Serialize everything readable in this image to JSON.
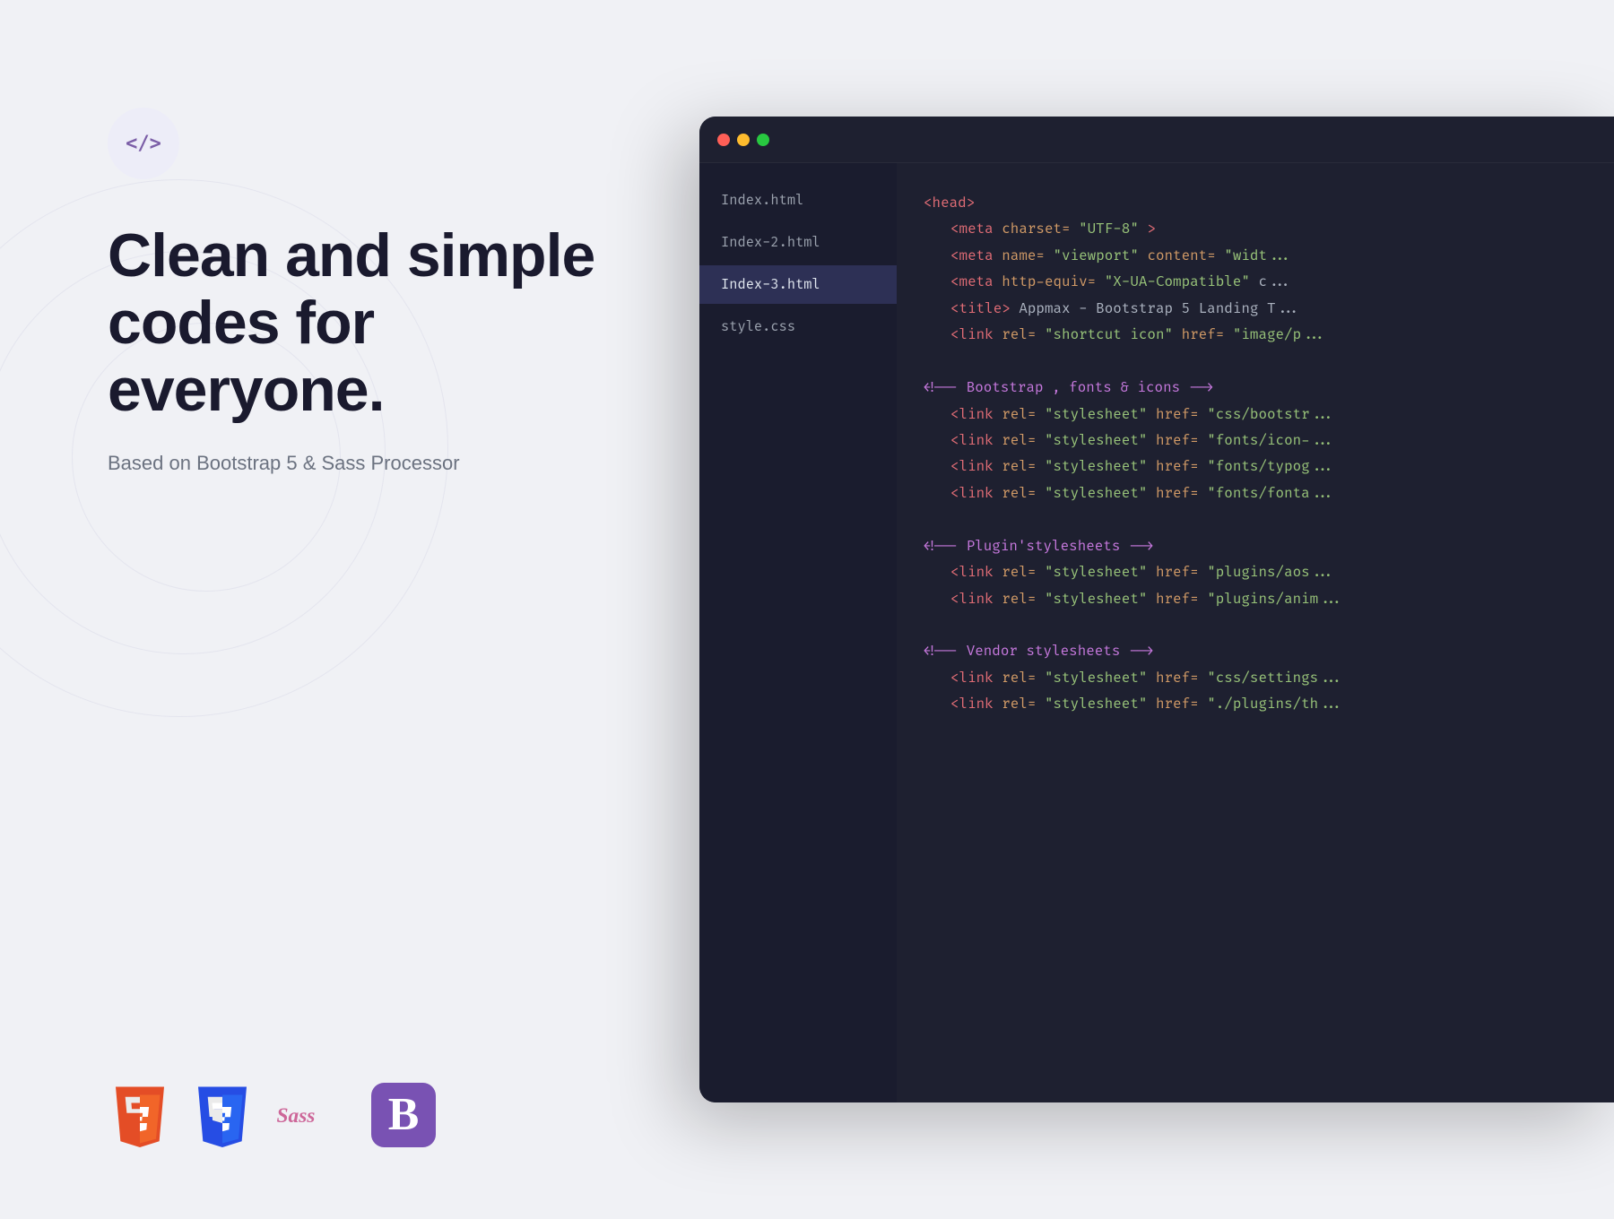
{
  "page": {
    "background_color": "#f0f1f5"
  },
  "left": {
    "icon_label": "</>",
    "hero_title": "Clean and simple codes for everyone.",
    "hero_subtitle": "Based on Bootstrap 5 & Sass Processor",
    "tech_logos": [
      "HTML5",
      "CSS3",
      "Sass",
      "Bootstrap"
    ]
  },
  "editor": {
    "titlebar": {
      "dots": [
        "red",
        "yellow",
        "green"
      ]
    },
    "sidebar": {
      "files": [
        {
          "name": "Index.html",
          "active": false
        },
        {
          "name": "Index-2.html",
          "active": false
        },
        {
          "name": "Index-3.html",
          "active": true
        },
        {
          "name": "style.css",
          "active": false
        }
      ]
    },
    "code_lines": [
      {
        "type": "tag",
        "text": "<head>"
      },
      {
        "type": "indent_mixed",
        "tag": "<meta",
        "attr": " charset=",
        "value": "\"UTF-8\"",
        "close": ">"
      },
      {
        "type": "indent_mixed",
        "tag": "<meta",
        "attr": " name=",
        "value": "\"viewport\"",
        "extra_attr": " content=",
        "extra_value": "\"widt..."
      },
      {
        "type": "indent_mixed",
        "tag": "<meta",
        "attr": " http-equiv=",
        "value": "\"X-UA-Compatible\"",
        "extra": " c..."
      },
      {
        "type": "indent_mixed",
        "tag": "<title>",
        "text": " Appmax - Bootstrap 5 Landing T..."
      },
      {
        "type": "indent_mixed",
        "tag": "<link",
        "attr": " rel=",
        "value": "\"shortcut icon\"",
        "extra_attr": " href=",
        "extra_value": "\"image/p..."
      },
      {
        "type": "blank"
      },
      {
        "type": "comment",
        "text": "<!-- Bootstrap , fonts & icons -->"
      },
      {
        "type": "indent_link",
        "attr": "rel=",
        "value": "\"stylesheet\"",
        "extra_attr": " href=",
        "extra_value": "\"css/bootstr..."
      },
      {
        "type": "indent_link",
        "attr": "rel=",
        "value": "\"stylesheet\"",
        "extra_attr": " href=",
        "extra_value": "\"fonts/icon-..."
      },
      {
        "type": "indent_link",
        "attr": "rel=",
        "value": "\"stylesheet\"",
        "extra_attr": " href=",
        "extra_value": "\"fonts/typog..."
      },
      {
        "type": "indent_link",
        "attr": "rel=",
        "value": "\"stylesheet\"",
        "extra_attr": " href=",
        "extra_value": "\"fonts/fonta..."
      },
      {
        "type": "blank"
      },
      {
        "type": "comment",
        "text": "<!-- Plugin'stylesheets -->"
      },
      {
        "type": "indent_link",
        "attr": "rel=",
        "value": "\"stylesheet\"",
        "extra_attr": " href=",
        "extra_value": "\"plugins/aos..."
      },
      {
        "type": "indent_link",
        "attr": "rel=",
        "value": "\"stylesheet\"",
        "extra_attr": " href=",
        "extra_value": "\"plugins/anim..."
      },
      {
        "type": "blank"
      },
      {
        "type": "comment",
        "text": "<!-- Vendor stylesheets -->"
      },
      {
        "type": "indent_link",
        "attr": "rel=",
        "value": "\"stylesheet\"",
        "extra_attr": " href=",
        "extra_value": "\"css/settings..."
      },
      {
        "type": "indent_link",
        "attr": "rel=",
        "value": "\"stylesheet\"",
        "extra_attr": " href=",
        "extra_value": "\"./plugins/th..."
      }
    ]
  }
}
